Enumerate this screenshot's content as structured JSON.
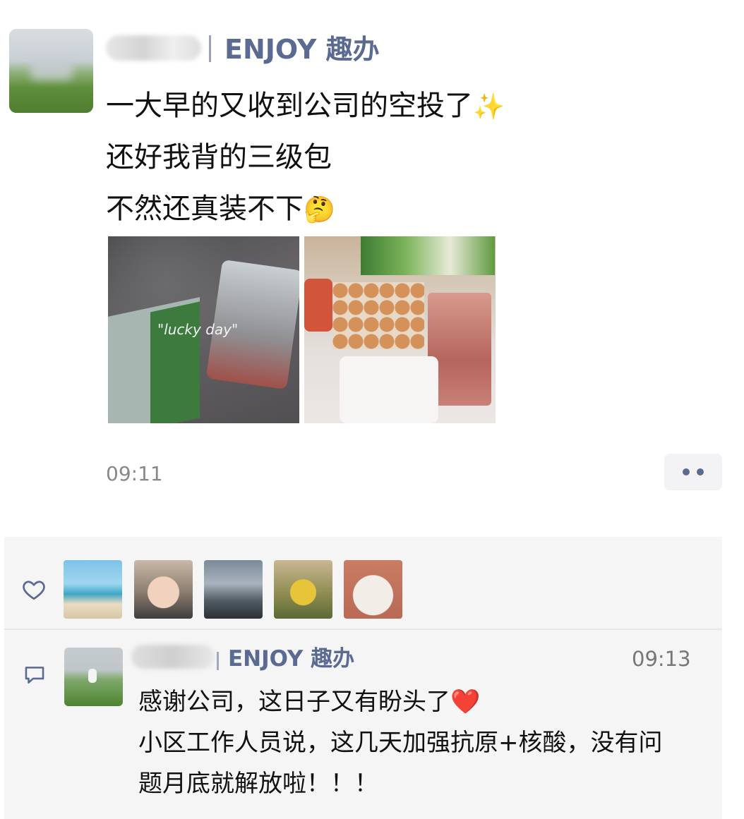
{
  "post": {
    "author_company": "ENJOY 趣办",
    "lines": [
      "一大早的又收到公司的空投了",
      "还好我背的三级包",
      "不然还真装不下"
    ],
    "emoji_sparkles": "✨",
    "emoji_thinking": "🤔",
    "photo_caption": "\"lucky day\"",
    "time": "09:11"
  },
  "likes": {
    "count_shown": 5
  },
  "comment": {
    "author_company": "ENJOY 趣办",
    "time": "09:13",
    "lines": [
      "感谢公司，这日子又有盼头了",
      "小区工作人员说，这几天加强抗原+核酸，没有问",
      "题月底就解放啦！！！"
    ],
    "emoji_heart": "❤️"
  },
  "colors": {
    "link_blue": "#5b6a92",
    "panel_bg": "#f5f5f5",
    "time_gray": "#888888"
  }
}
